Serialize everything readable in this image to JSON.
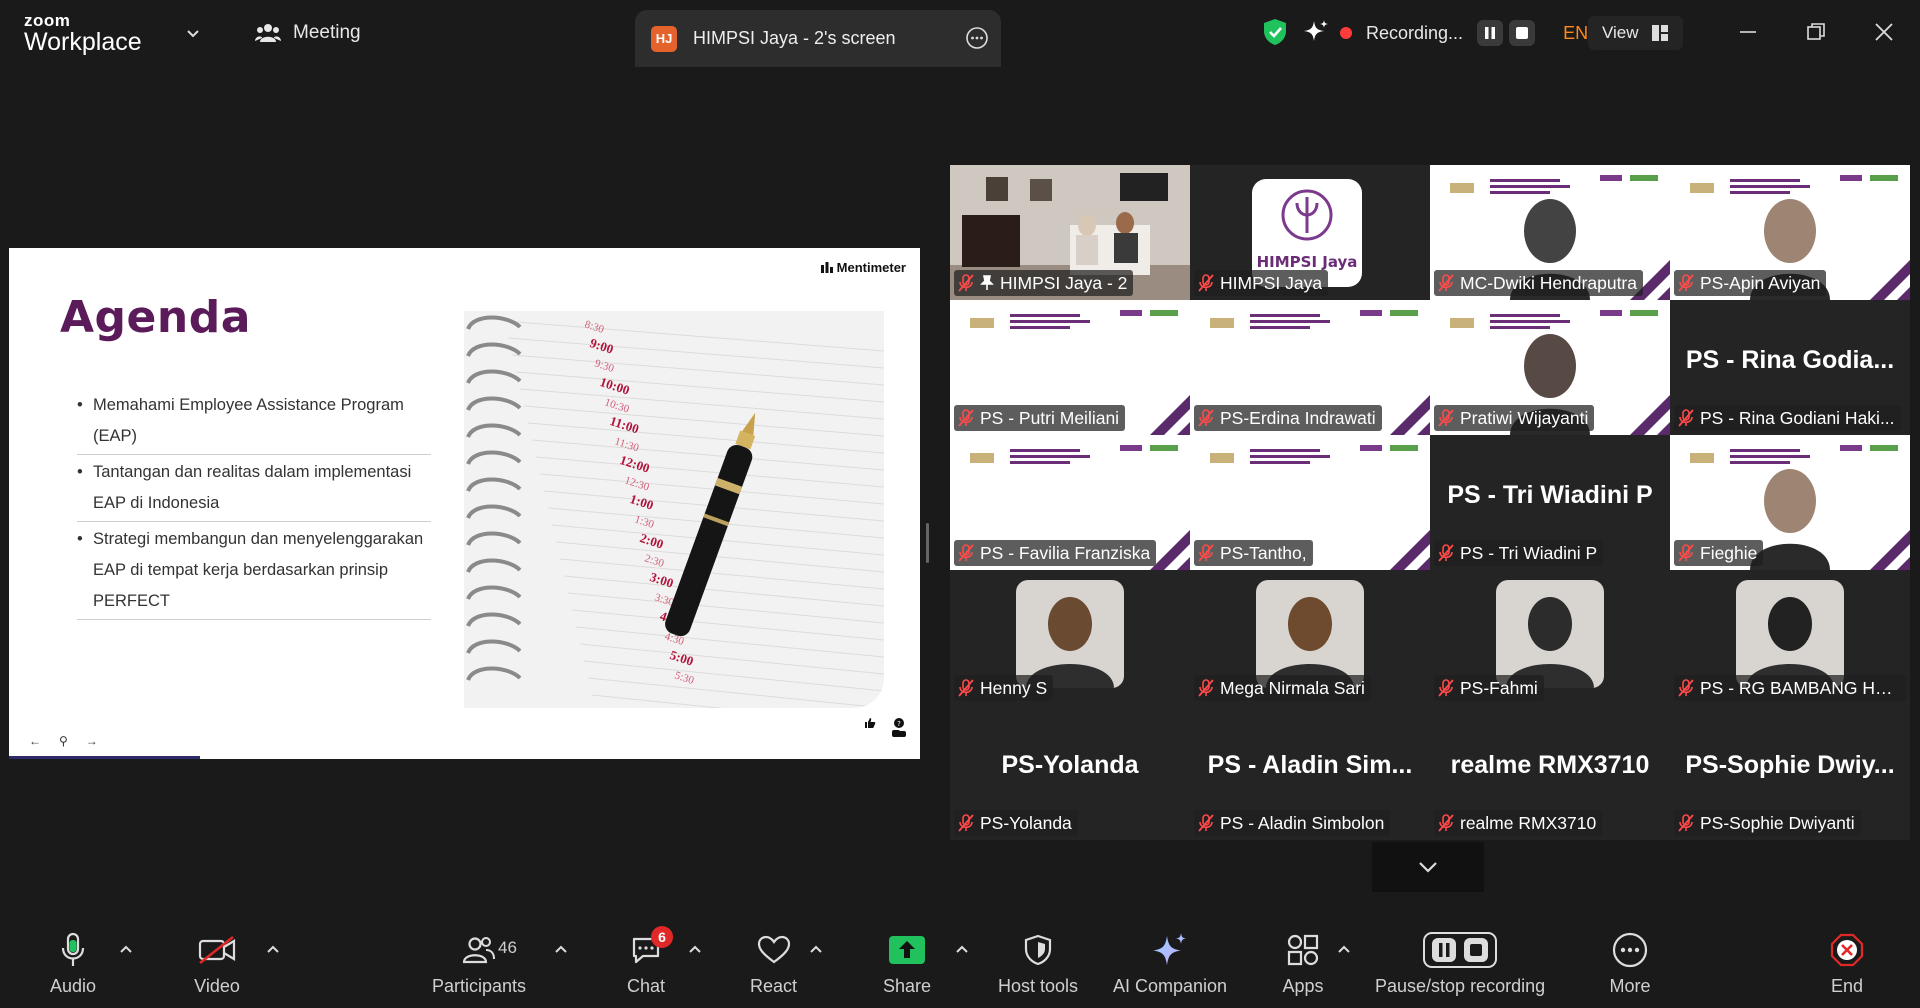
{
  "topbar": {
    "logo_top": "zoom",
    "logo_bottom": "Workplace",
    "meeting_label": "Meeting",
    "share_tab_initials": "HJ",
    "share_tab_label": "HIMPSI Jaya - 2's screen",
    "recording_label": "Recording...",
    "language": "EN",
    "view_label": "View"
  },
  "slide": {
    "brand": "Mentimeter",
    "title": "Agenda",
    "bullets": [
      "Memahami Employee Assistance Program (EAP)",
      "Tantangan dan realitas dalam implementasi EAP di Indonesia",
      "Strategi membangun dan menyelenggarakan EAP di tempat kerja berdasarkan prinsip PERFECT"
    ],
    "planner_times": [
      "8:30",
      "9:00",
      "9:30",
      "10:00",
      "10:30",
      "11:00",
      "11:30",
      "12:00",
      "12:30",
      "1:00",
      "1:30",
      "2:00",
      "2:30",
      "3:00",
      "3:30",
      "4:00",
      "4:30",
      "5:00",
      "5:30"
    ],
    "nav_prev": "←",
    "nav_pin": "⚲",
    "nav_next": "→"
  },
  "gallery": {
    "logo_text": "HIMPSI Jaya",
    "tiles": [
      {
        "name": "HIMPSI Jaya - 2",
        "big": ""
      },
      {
        "name": "HIMPSI Jaya",
        "big": ""
      },
      {
        "name": "MC-Dwiki Hendraputra",
        "big": ""
      },
      {
        "name": "PS-Apin Aviyan",
        "big": ""
      },
      {
        "name": "PS - Putri Meiliani",
        "big": ""
      },
      {
        "name": "PS-Erdina Indrawati",
        "big": ""
      },
      {
        "name": "Pratiwi Wijayanti",
        "big": ""
      },
      {
        "name": "PS - Rina Godiani Haki...",
        "big": "PS - Rina Godia..."
      },
      {
        "name": "PS - Favilia Franziska",
        "big": ""
      },
      {
        "name": "PS-Tantho,",
        "big": ""
      },
      {
        "name": "PS - Tri Wiadini P",
        "big": "PS - Tri Wiadini P"
      },
      {
        "name": "Fieghie",
        "big": ""
      },
      {
        "name": "Henny S",
        "big": ""
      },
      {
        "name": "Mega Nirmala Sari",
        "big": ""
      },
      {
        "name": "PS-Fahmi",
        "big": ""
      },
      {
        "name": "PS - RG BAMBANG HA...",
        "big": ""
      },
      {
        "name": "PS-Yolanda",
        "big": "PS-Yolanda"
      },
      {
        "name": "PS - Aladin Simbolon",
        "big": "PS - Aladin Sim..."
      },
      {
        "name": "realme RMX3710",
        "big": "realme RMX3710"
      },
      {
        "name": "PS-Sophie Dwiyanti",
        "big": "PS-Sophie Dwiy..."
      }
    ]
  },
  "toolbar": {
    "audio": "Audio",
    "video": "Video",
    "participants": "Participants",
    "participants_count": "46",
    "chat": "Chat",
    "chat_badge": "6",
    "react": "React",
    "share": "Share",
    "host_tools": "Host tools",
    "ai_companion": "AI Companion",
    "apps": "Apps",
    "pause_recording": "Pause/stop recording",
    "more": "More",
    "end": "End"
  },
  "colors": {
    "active_speaker": "#23d962",
    "share_green": "#21c25e",
    "agenda_purple": "#5b1a59",
    "end_red": "#e02828",
    "lang_orange": "#ff8a1a"
  }
}
